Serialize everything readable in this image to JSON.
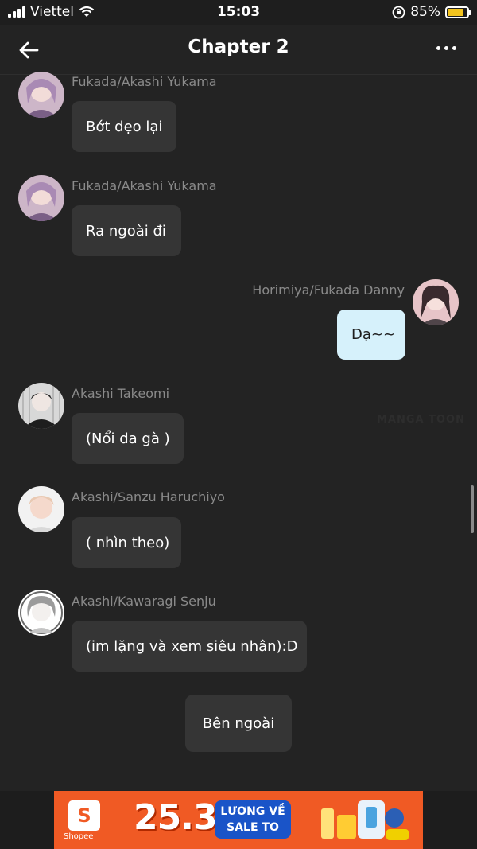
{
  "status_bar": {
    "carrier": "Viettel",
    "time": "15:03",
    "battery": "85%"
  },
  "header": {
    "title": "Chapter 2"
  },
  "messages": [
    {
      "name": "Fukada/Akashi Yukama",
      "text": "Bớt dẹo lại"
    },
    {
      "name": "Fukada/Akashi Yukama",
      "text": "Ra ngoài đi"
    },
    {
      "name": "Horimiya/Fukada Danny",
      "text": "Dạ~~"
    },
    {
      "name": "Akashi Takeomi",
      "text": "(Nổi da gà )"
    },
    {
      "name": "Akashi/Sanzu Haruchiyo",
      "text": "( nhìn theo)"
    },
    {
      "name": "Akashi/Kawaragi Senju",
      "text": "(im lặng và xem siêu nhân):D"
    }
  ],
  "narration": {
    "text": "Bên ngoài"
  },
  "ad": {
    "brand_label": "Shopee",
    "logo_glyph": "S",
    "number": "25.3",
    "badge_line1": "LƯƠNG VỀ",
    "badge_line2": "SALE TO"
  },
  "colors": {
    "background": "#232323",
    "bubble": "#353535",
    "my_bubble": "#d6f1fb",
    "battery": "#f4c51f",
    "ad": "#f05a24"
  }
}
